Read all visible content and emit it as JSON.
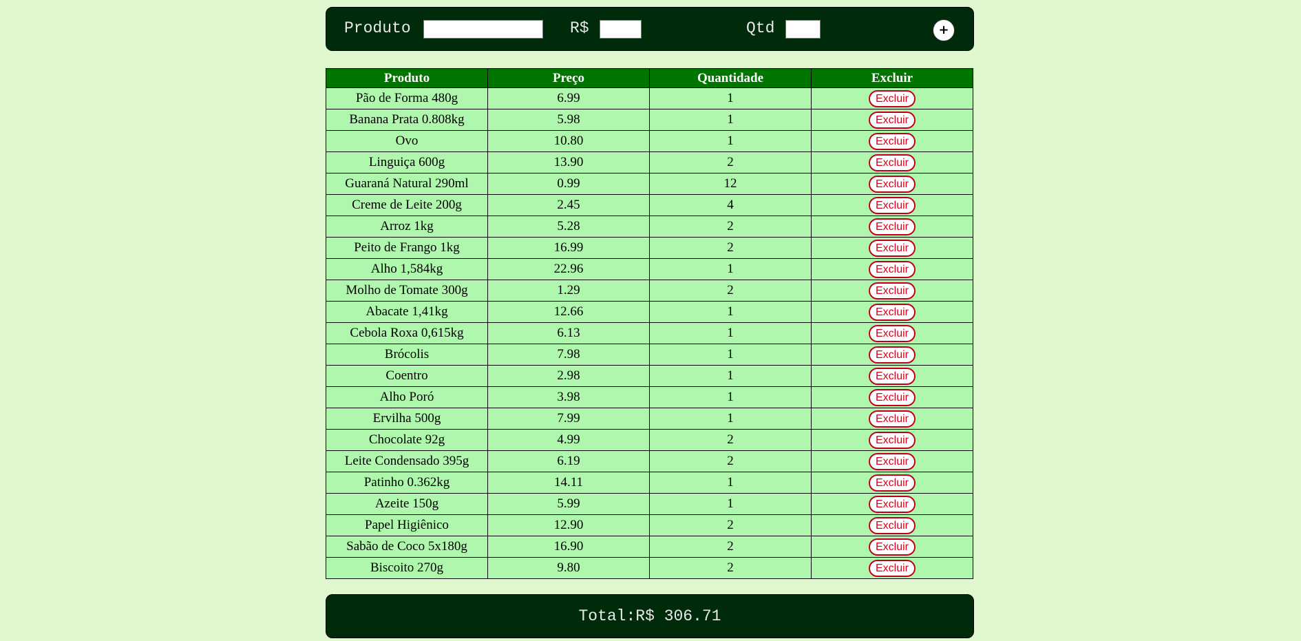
{
  "form": {
    "produto_label": "Produto",
    "produto_value": "",
    "preco_label": "R$",
    "preco_value": "",
    "qtd_label": "Qtd",
    "qtd_value": "",
    "add_label": "+"
  },
  "table": {
    "headers": [
      "Produto",
      "Preço",
      "Quantidade",
      "Excluir"
    ],
    "delete_label": "Excluir",
    "rows": [
      {
        "produto": "Pão de Forma 480g",
        "preco": "6.99",
        "quantidade": "1"
      },
      {
        "produto": "Banana Prata 0.808kg",
        "preco": "5.98",
        "quantidade": "1"
      },
      {
        "produto": "Ovo",
        "preco": "10.80",
        "quantidade": "1"
      },
      {
        "produto": "Linguiça 600g",
        "preco": "13.90",
        "quantidade": "2"
      },
      {
        "produto": "Guaraná Natural 290ml",
        "preco": "0.99",
        "quantidade": "12"
      },
      {
        "produto": "Creme de Leite 200g",
        "preco": "2.45",
        "quantidade": "4"
      },
      {
        "produto": "Arroz 1kg",
        "preco": "5.28",
        "quantidade": "2"
      },
      {
        "produto": "Peito de Frango 1kg",
        "preco": "16.99",
        "quantidade": "2"
      },
      {
        "produto": "Alho 1,584kg",
        "preco": "22.96",
        "quantidade": "1"
      },
      {
        "produto": "Molho de Tomate 300g",
        "preco": "1.29",
        "quantidade": "2"
      },
      {
        "produto": "Abacate 1,41kg",
        "preco": "12.66",
        "quantidade": "1"
      },
      {
        "produto": "Cebola Roxa 0,615kg",
        "preco": "6.13",
        "quantidade": "1"
      },
      {
        "produto": "Brócolis",
        "preco": "7.98",
        "quantidade": "1"
      },
      {
        "produto": "Coentro",
        "preco": "2.98",
        "quantidade": "1"
      },
      {
        "produto": "Alho Poró",
        "preco": "3.98",
        "quantidade": "1"
      },
      {
        "produto": "Ervilha 500g",
        "preco": "7.99",
        "quantidade": "1"
      },
      {
        "produto": "Chocolate 92g",
        "preco": "4.99",
        "quantidade": "2"
      },
      {
        "produto": "Leite Condensado 395g",
        "preco": "6.19",
        "quantidade": "2"
      },
      {
        "produto": "Patinho 0.362kg",
        "preco": "14.11",
        "quantidade": "1"
      },
      {
        "produto": "Azeite 150g",
        "preco": "5.99",
        "quantidade": "1"
      },
      {
        "produto": "Papel Higiênico",
        "preco": "12.90",
        "quantidade": "2"
      },
      {
        "produto": "Sabão de Coco 5x180g",
        "preco": "16.90",
        "quantidade": "2"
      },
      {
        "produto": "Biscoito 270g",
        "preco": "9.80",
        "quantidade": "2"
      }
    ]
  },
  "total": {
    "text": "Total:R$ 306.71"
  },
  "colors": {
    "page_background": "#dff8cf",
    "bar_background": "#002b0b",
    "header_background": "#007500",
    "row_background": "#aff7ad",
    "delete_text": "#d9001b"
  }
}
